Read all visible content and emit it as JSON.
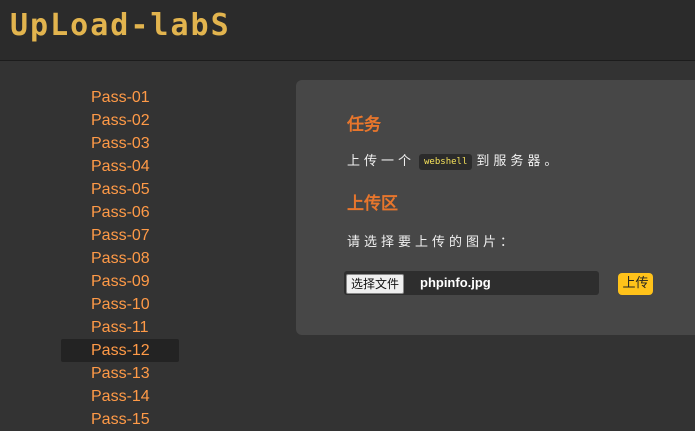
{
  "header": {
    "logo_text": "UpLoad-labS"
  },
  "sidebar": {
    "active_index": 11,
    "items": [
      {
        "label": "Pass-01"
      },
      {
        "label": "Pass-02"
      },
      {
        "label": "Pass-03"
      },
      {
        "label": "Pass-04"
      },
      {
        "label": "Pass-05"
      },
      {
        "label": "Pass-06"
      },
      {
        "label": "Pass-07"
      },
      {
        "label": "Pass-08"
      },
      {
        "label": "Pass-09"
      },
      {
        "label": "Pass-10"
      },
      {
        "label": "Pass-11"
      },
      {
        "label": "Pass-12"
      },
      {
        "label": "Pass-13"
      },
      {
        "label": "Pass-14"
      },
      {
        "label": "Pass-15"
      }
    ]
  },
  "main": {
    "task_title": "任务",
    "task_prefix": "上传一个",
    "task_code": "webshell",
    "task_suffix": "到服务器。",
    "upload_title": "上传区",
    "prompt": "请选择要上传的图片：",
    "file_button_label": "选择文件",
    "file_name": "phpinfo.jpg",
    "upload_button_label": "上传"
  },
  "colors": {
    "background": "#333333",
    "header": "#2b2b2b",
    "logo": "#e2b44e",
    "nav_link": "#ff9a47",
    "section_title": "#e8762c",
    "panel": "#474747",
    "upload_button": "#ffc21a",
    "code_text": "#f6e25a"
  }
}
